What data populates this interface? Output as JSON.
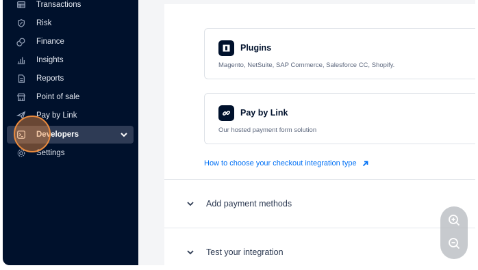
{
  "sidebar": {
    "items": [
      {
        "label": "Transactions",
        "icon": "table-icon"
      },
      {
        "label": "Risk",
        "icon": "shield-icon"
      },
      {
        "label": "Finance",
        "icon": "coins-icon"
      },
      {
        "label": "Insights",
        "icon": "bar-chart-icon"
      },
      {
        "label": "Reports",
        "icon": "document-icon"
      },
      {
        "label": "Point of sale",
        "icon": "storefront-icon"
      },
      {
        "label": "Pay by Link",
        "icon": "paper-plane-icon"
      },
      {
        "label": "Developers",
        "icon": "terminal-icon"
      },
      {
        "label": "Settings",
        "icon": "gear-icon"
      }
    ]
  },
  "main": {
    "cards": [
      {
        "title": "Plugins",
        "description": "Magento, NetSuite, SAP Commerce, Salesforce CC, Shopify.",
        "icon": "plugin-icon"
      },
      {
        "title": "Pay by Link",
        "description": "Our hosted payment form solution",
        "icon": "link-icon"
      }
    ],
    "help_link": "How to choose your checkout integration type",
    "sections": [
      {
        "label": "Add payment methods"
      },
      {
        "label": "Test your integration"
      }
    ]
  },
  "colors": {
    "sidebar_bg": "#00112c",
    "active_item_bg": "#2e3b55",
    "link": "#0070f5",
    "cursor_ring": "#e98a3e"
  }
}
